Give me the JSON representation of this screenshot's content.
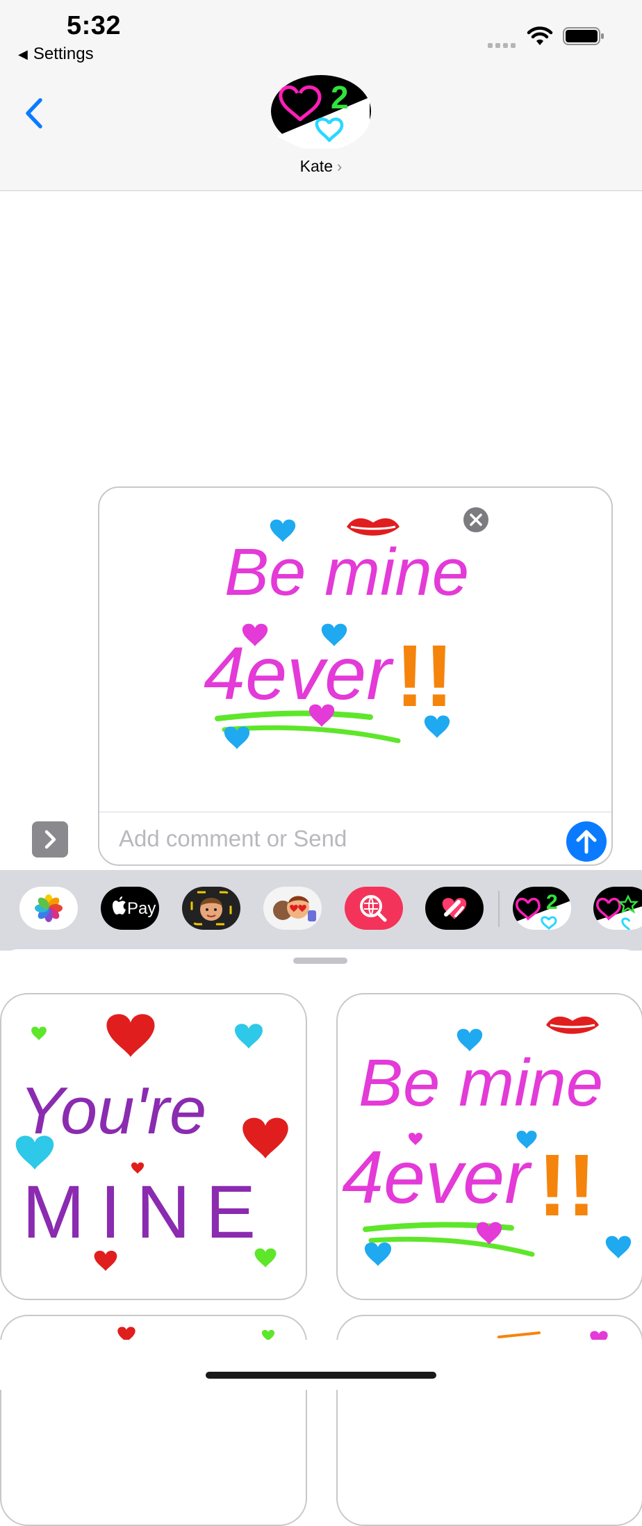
{
  "status_bar": {
    "time": "5:32",
    "back_label": "Settings",
    "icons": [
      "cellular-signal-icon",
      "wifi-icon",
      "battery-icon"
    ]
  },
  "conversation": {
    "contact_name": "Kate",
    "contact_chevron": "›"
  },
  "compose": {
    "input_placeholder": "Add comment or Send",
    "sticker_text_1": "Be mine",
    "sticker_text_2": "4ever",
    "sticker_text_3": "!!"
  },
  "apps": [
    {
      "name": "Photos"
    },
    {
      "name": "Apple Pay",
      "label": "Pay"
    },
    {
      "name": "Memoji"
    },
    {
      "name": "Memoji Stickers"
    },
    {
      "name": "Search Images"
    },
    {
      "name": "Digital Touch"
    },
    {
      "name": "Valentine Stickers 2"
    },
    {
      "name": "Valentine Stickers"
    }
  ],
  "sticker_grid": {
    "card_1": {
      "line_1": "You're",
      "line_2": "MINE"
    },
    "card_2": {
      "line_1": "Be mine",
      "line_2": "4ever",
      "line_3": "!!"
    }
  },
  "colors": {
    "accent_blue": "#0a7bff",
    "magenta": "#e33ad8",
    "purple": "#8a2bb0",
    "orange": "#f5840c",
    "cyan": "#1ea9f0",
    "green": "#5ee62a",
    "red": "#e01e1e"
  }
}
